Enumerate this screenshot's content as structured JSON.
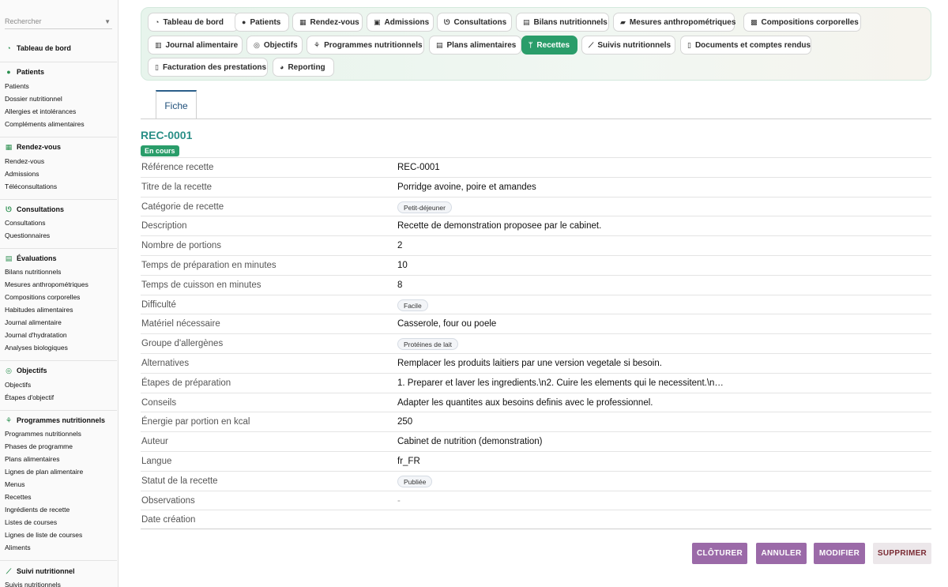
{
  "search": {
    "placeholder": "Rechercher"
  },
  "sidebar": {
    "groups": [
      {
        "title": "Tableau de bord",
        "icon": "dashboard-icon",
        "items": []
      },
      {
        "title": "Patients",
        "icon": "user-icon",
        "items": [
          "Patients",
          "Dossier nutritionnel",
          "Allergies et intolérances",
          "Compléments alimentaires"
        ]
      },
      {
        "title": "Rendez-vous",
        "icon": "calendar-icon",
        "items": [
          "Rendez-vous",
          "Admissions",
          "Téléconsultations"
        ]
      },
      {
        "title": "Consultations",
        "icon": "stethoscope-icon",
        "items": [
          "Consultations",
          "Questionnaires"
        ]
      },
      {
        "title": "Évaluations",
        "icon": "clipboard-icon",
        "items": [
          "Bilans nutritionnels",
          "Mesures anthropométriques",
          "Compositions corporelles",
          "Habitudes alimentaires",
          "Journal alimentaire",
          "Journal d'hydratation",
          "Analyses biologiques"
        ]
      },
      {
        "title": "Objectifs",
        "icon": "target-icon",
        "items": [
          "Objectifs",
          "Étapes d'objectif"
        ]
      },
      {
        "title": "Programmes nutritionnels",
        "icon": "sprout-icon",
        "items": [
          "Programmes nutritionnels",
          "Phases de programme",
          "Plans alimentaires",
          "Lignes de plan alimentaire",
          "Menus",
          "Recettes",
          "Ingrédients de recette",
          "Listes de courses",
          "Lignes de liste de courses",
          "Aliments"
        ]
      },
      {
        "title": "Suivi nutritionnel",
        "icon": "chart-line-icon",
        "items": [
          "Suivis nutritionnels"
        ]
      }
    ]
  },
  "menu": {
    "items": [
      {
        "label": "Tableau de bord",
        "icon": "dashboard-icon",
        "active": false
      },
      {
        "label": "Patients",
        "icon": "user-icon",
        "active": false
      },
      {
        "label": "Rendez-vous",
        "icon": "calendar-icon",
        "active": false
      },
      {
        "label": "Admissions",
        "icon": "admission-icon",
        "active": false
      },
      {
        "label": "Consultations",
        "icon": "stethoscope-icon",
        "active": false
      },
      {
        "label": "Bilans nutritionnels",
        "icon": "clipboard-icon",
        "active": false
      },
      {
        "label": "Mesures anthropométriques",
        "icon": "ruler-icon",
        "active": false
      },
      {
        "label": "Compositions corporelles",
        "icon": "scale-icon",
        "active": false
      },
      {
        "label": "Journal alimentaire",
        "icon": "book-icon",
        "active": false
      },
      {
        "label": "Objectifs",
        "icon": "target-icon",
        "active": false
      },
      {
        "label": "Programmes nutritionnels",
        "icon": "sprout-icon",
        "active": false
      },
      {
        "label": "Plans alimentaires",
        "icon": "clipboard-icon",
        "active": false
      },
      {
        "label": "Recettes",
        "icon": "utensils-icon",
        "active": true
      },
      {
        "label": "Suivis nutritionnels",
        "icon": "chart-line-icon",
        "active": false
      },
      {
        "label": "Documents et comptes rendus",
        "icon": "document-icon",
        "active": false
      },
      {
        "label": "Facturation des prestations",
        "icon": "invoice-icon",
        "active": false
      },
      {
        "label": "Reporting",
        "icon": "pie-chart-icon",
        "active": false
      }
    ]
  },
  "tabs": [
    {
      "label": "Fiche"
    }
  ],
  "record": {
    "title": "REC-0001",
    "status": "En cours",
    "fields": [
      {
        "label": "Référence recette",
        "value": "REC-0001",
        "type": "text"
      },
      {
        "label": "Titre de la recette",
        "value": "Porridge avoine, poire et amandes",
        "type": "text"
      },
      {
        "label": "Catégorie de recette",
        "value": "Petit-déjeuner",
        "type": "tag"
      },
      {
        "label": "Description",
        "value": "Recette de demonstration proposee par le cabinet.",
        "type": "text"
      },
      {
        "label": "Nombre de portions",
        "value": "2",
        "type": "text"
      },
      {
        "label": "Temps de préparation en minutes",
        "value": "10",
        "type": "text"
      },
      {
        "label": "Temps de cuisson en minutes",
        "value": "8",
        "type": "text"
      },
      {
        "label": "Difficulté",
        "value": "Facile",
        "type": "tag"
      },
      {
        "label": "Matériel nécessaire",
        "value": "Casserole, four ou poele",
        "type": "text"
      },
      {
        "label": "Groupe d'allergènes",
        "value": "Protéines de lait",
        "type": "tag"
      },
      {
        "label": "Alternatives",
        "value": "Remplacer les produits laitiers par une version vegetale si besoin.",
        "type": "text"
      },
      {
        "label": "Étapes de préparation",
        "value": "1. Preparer et laver les ingredients.\\n2. Cuire les elements qui le necessitent.\\n…",
        "type": "text"
      },
      {
        "label": "Conseils",
        "value": "Adapter les quantites aux besoins definis avec le professionnel.",
        "type": "text"
      },
      {
        "label": "Énergie par portion en kcal",
        "value": "250",
        "type": "text"
      },
      {
        "label": "Auteur",
        "value": "Cabinet de nutrition (demonstration)",
        "type": "text"
      },
      {
        "label": "Langue",
        "value": "fr_FR",
        "type": "text"
      },
      {
        "label": "Statut de la recette",
        "value": "Publiée",
        "type": "tag"
      },
      {
        "label": "Observations",
        "value": "-",
        "type": "muted"
      },
      {
        "label": "Date création",
        "value": "",
        "type": "text"
      }
    ]
  },
  "actions": [
    {
      "label": "CLÔTURER",
      "style": "primary"
    },
    {
      "label": "ANNULER",
      "style": "primary"
    },
    {
      "label": "MODIFIER",
      "style": "primary"
    },
    {
      "label": "SUPPRIMER",
      "style": "danger"
    }
  ],
  "colors": {
    "accent": "#2a9d6a",
    "title": "#2a8f87",
    "action": "#9b6aa8"
  }
}
